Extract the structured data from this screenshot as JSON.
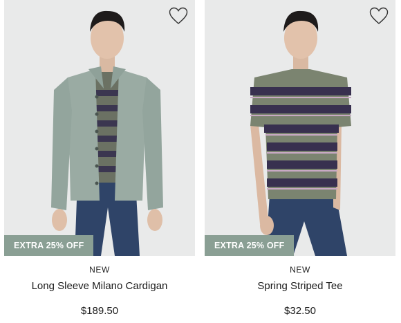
{
  "products": [
    {
      "tag": "NEW",
      "name": "Long Sleeve Milano Cardigan",
      "price": "$189.50",
      "promo": "EXTRA 25% OFF",
      "wishlist_icon": "heart-outline-icon",
      "colors": {
        "garment": "#9aaba3",
        "tee": "#6b7163",
        "stripe": "#3b3650",
        "jeans": "#2f4468",
        "background": "#e9eaea"
      }
    },
    {
      "tag": "NEW",
      "name": "Spring Striped Tee",
      "price": "$32.50",
      "promo": "EXTRA 25% OFF",
      "wishlist_icon": "heart-outline-icon",
      "colors": {
        "garment": "#7b8470",
        "stripe": "#38304f",
        "pinstripe": "#c9a9c4",
        "jeans": "#2f4468",
        "background": "#e9eaea"
      }
    }
  ],
  "theme": {
    "promo_badge_color": "#8a9f94",
    "text_color": "#111111"
  }
}
